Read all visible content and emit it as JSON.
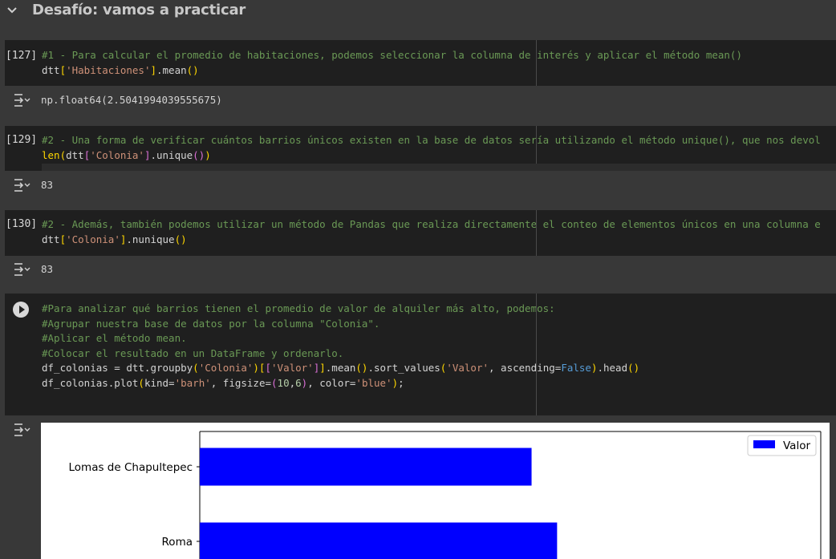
{
  "section": {
    "title": "Desafío: vamos a practicar"
  },
  "cells": [
    {
      "count": "[127]",
      "code": [
        [
          {
            "t": "#1 - Para calcular el promedio de habitaciones, podemos seleccionar la columna de interés y aplicar el método mean()",
            "c": "cm"
          }
        ],
        [
          {
            "t": "dtt",
            "c": ""
          },
          {
            "t": "[",
            "c": "by"
          },
          {
            "t": "'Habitaciones'",
            "c": "st"
          },
          {
            "t": "]",
            "c": "by"
          },
          {
            "t": ".mean",
            "c": ""
          },
          {
            "t": "()",
            "c": "by"
          }
        ]
      ],
      "output": "np.float64(2.5041994039555675)"
    },
    {
      "count": "[129]",
      "code": [
        [
          {
            "t": "#2 - Una forma de verificar cuántos barrios únicos existen en la base de datos sería utilizando el método unique(), que nos devol",
            "c": "cm"
          }
        ],
        [
          {
            "t": "len",
            "c": "by"
          },
          {
            "t": "(",
            "c": "by"
          },
          {
            "t": "dtt",
            "c": ""
          },
          {
            "t": "[",
            "c": "bp"
          },
          {
            "t": "'Colonia'",
            "c": "st"
          },
          {
            "t": "]",
            "c": "bp"
          },
          {
            "t": ".unique",
            "c": ""
          },
          {
            "t": "()",
            "c": "bp"
          },
          {
            "t": ")",
            "c": "by"
          }
        ]
      ],
      "output": "83"
    },
    {
      "count": "[130]",
      "code": [
        [
          {
            "t": "#2 - Además, también podemos utilizar un método de Pandas que realiza directamente el conteo de elementos únicos en una columna e",
            "c": "cm"
          }
        ],
        [
          {
            "t": "dtt",
            "c": ""
          },
          {
            "t": "[",
            "c": "by"
          },
          {
            "t": "'Colonia'",
            "c": "st"
          },
          {
            "t": "]",
            "c": "by"
          },
          {
            "t": ".nunique",
            "c": ""
          },
          {
            "t": "()",
            "c": "by"
          }
        ]
      ],
      "output": "83"
    },
    {
      "count": "",
      "code": [
        [
          {
            "t": "#Para analizar qué barrios tienen el promedio de valor de alquiler más alto, podemos:",
            "c": "cm"
          }
        ],
        [
          {
            "t": "#Agrupar nuestra base de datos por la columna \"Colonia\".",
            "c": "cm"
          }
        ],
        [
          {
            "t": "#Aplicar el método mean.",
            "c": "cm"
          }
        ],
        [
          {
            "t": "#Colocar el resultado en un DataFrame y ordenarlo.",
            "c": "cm"
          }
        ],
        [
          {
            "t": "df_colonias = dtt.groupby",
            "c": ""
          },
          {
            "t": "(",
            "c": "by"
          },
          {
            "t": "'Colonia'",
            "c": "st"
          },
          {
            "t": ")",
            "c": "by"
          },
          {
            "t": "[",
            "c": "by"
          },
          {
            "t": "[",
            "c": "bp"
          },
          {
            "t": "'Valor'",
            "c": "st"
          },
          {
            "t": "]",
            "c": "bp"
          },
          {
            "t": "]",
            "c": "by"
          },
          {
            "t": ".mean",
            "c": ""
          },
          {
            "t": "()",
            "c": "by"
          },
          {
            "t": ".sort_values",
            "c": ""
          },
          {
            "t": "(",
            "c": "by"
          },
          {
            "t": "'Valor'",
            "c": "st"
          },
          {
            "t": ", ascending=",
            "c": ""
          },
          {
            "t": "False",
            "c": "kw"
          },
          {
            "t": ")",
            "c": "by"
          },
          {
            "t": ".head",
            "c": ""
          },
          {
            "t": "()",
            "c": "by"
          }
        ],
        [
          {
            "t": "df_colonias.plot",
            "c": ""
          },
          {
            "t": "(",
            "c": "by"
          },
          {
            "t": "kind=",
            "c": ""
          },
          {
            "t": "'barh'",
            "c": "st"
          },
          {
            "t": ", figsize=",
            "c": ""
          },
          {
            "t": "(",
            "c": "bp"
          },
          {
            "t": "10",
            "c": "nu"
          },
          {
            "t": ",",
            "c": ""
          },
          {
            "t": "6",
            "c": "nu"
          },
          {
            "t": ")",
            "c": "bp"
          },
          {
            "t": ", color=",
            "c": ""
          },
          {
            "t": "'blue'",
            "c": "st"
          },
          {
            "t": ")",
            "c": "by"
          },
          {
            "t": ";",
            "c": ""
          }
        ]
      ]
    }
  ],
  "chart_data": {
    "type": "bar",
    "orientation": "horizontal",
    "categories": [
      "Lomas de Chapultepec",
      "Roma"
    ],
    "series": [
      {
        "name": "Valor",
        "values": [
          0.78,
          0.84
        ],
        "color": "#0000ff"
      }
    ],
    "legend": "top-right",
    "note": "chart is cropped at the bottom; only the first two bars are visible and the x-axis is not shown"
  }
}
